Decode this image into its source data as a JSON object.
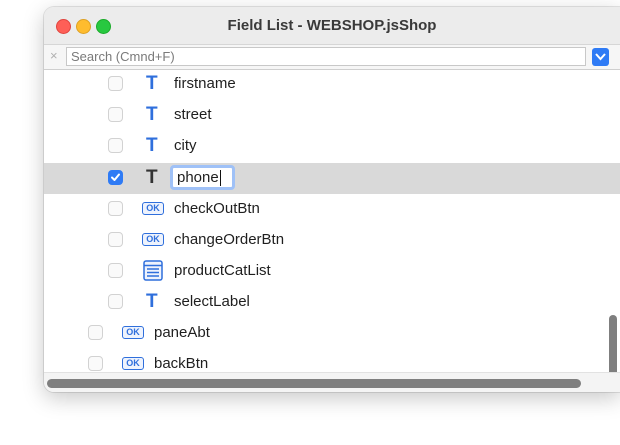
{
  "window": {
    "title": "Field List - WEBSHOP.jsShop"
  },
  "search": {
    "placeholder": "Search (Cmnd+F)",
    "clear_icon": "×"
  },
  "fields": [
    {
      "name": "firstname",
      "type": "text",
      "icon": "T",
      "checked": false
    },
    {
      "name": "street",
      "type": "text",
      "icon": "T",
      "checked": false
    },
    {
      "name": "city",
      "type": "text",
      "icon": "T",
      "checked": false
    },
    {
      "name": "phone",
      "type": "text",
      "icon": "T",
      "checked": true,
      "selected": true,
      "editing": true
    },
    {
      "name": "checkOutBtn",
      "type": "button",
      "icon": "OK",
      "checked": false
    },
    {
      "name": "changeOrderBtn",
      "type": "button",
      "icon": "OK",
      "checked": false
    },
    {
      "name": "productCatList",
      "type": "list",
      "icon": "list-icon",
      "checked": false
    },
    {
      "name": "selectLabel",
      "type": "text",
      "icon": "T",
      "checked": false
    },
    {
      "name": "paneAbt",
      "type": "button",
      "icon": "OK",
      "checked": false
    },
    {
      "name": "backBtn",
      "type": "button",
      "icon": "OK",
      "checked": false
    }
  ],
  "colors": {
    "accent": "#2f7bf5",
    "icon_blue": "#2f6fdc",
    "selection": "#d9d9d9"
  }
}
